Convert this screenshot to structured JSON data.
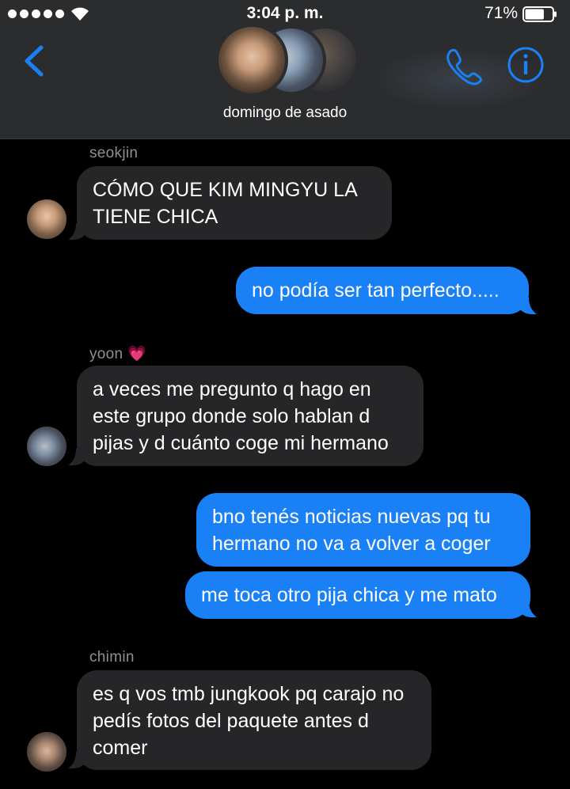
{
  "status_bar": {
    "time": "3:04 p. m.",
    "battery": "71%",
    "battery_level": 0.71,
    "signal_bars": 5
  },
  "header": {
    "group_name": "domingo de asado",
    "back_icon": "chevron-left-icon",
    "call_icon": "phone-icon",
    "info_icon": "info-icon",
    "accent": "#1a80f5"
  },
  "messages": [
    {
      "direction": "in",
      "sender": "seokjin",
      "text": "CÓMO QUE KIM MINGYU LA TIENE CHICA"
    },
    {
      "direction": "out",
      "text": "no podía ser tan perfecto....."
    },
    {
      "direction": "in",
      "sender": "yoon 💗",
      "text": "a veces me pregunto q hago en este grupo donde solo hablan d pijas y d cuánto coge mi hermano"
    },
    {
      "direction": "out",
      "text": "bno tenés noticias nuevas pq tu hermano no va a volver a coger"
    },
    {
      "direction": "out",
      "text": "me toca otro pija chica y me mato"
    },
    {
      "direction": "in",
      "sender": "chimin",
      "text": "es q vos tmb jungkook pq carajo no pedís fotos del paquete antes d comer"
    }
  ],
  "colors": {
    "incoming_bubble": "#262629",
    "outgoing_bubble": "#1a80f5",
    "background": "#000000",
    "sender_name": "#8e8e93"
  }
}
